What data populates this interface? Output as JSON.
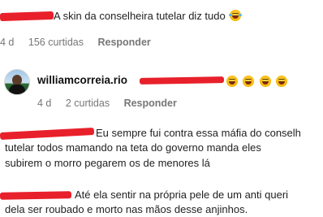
{
  "comment1": {
    "text": "A skin da conselheira tutelar diz tudo",
    "time": "4 d",
    "likes": "156 curtidas",
    "reply": "Responder"
  },
  "comment2": {
    "username": "williamcorreia.rio",
    "time": "4 d",
    "likes": "2 curtidas",
    "reply": "Responder"
  },
  "comment3": {
    "line1": "Eu sempre fui contra essa máfia do conselh",
    "line2": "tutelar todos mamando na teta do governo manda eles",
    "line3": "subirem o morro pegarem os de menores lá"
  },
  "comment4": {
    "line1": "Até ela sentir na própria pele de um anti queri",
    "line2": "dela ser roubado e morto nas mãos desse anjinhos."
  },
  "icons": {
    "emoji": "face-with-tears-of-joy",
    "redaction_color": "#e8202b",
    "avatar": "profile-avatar"
  }
}
